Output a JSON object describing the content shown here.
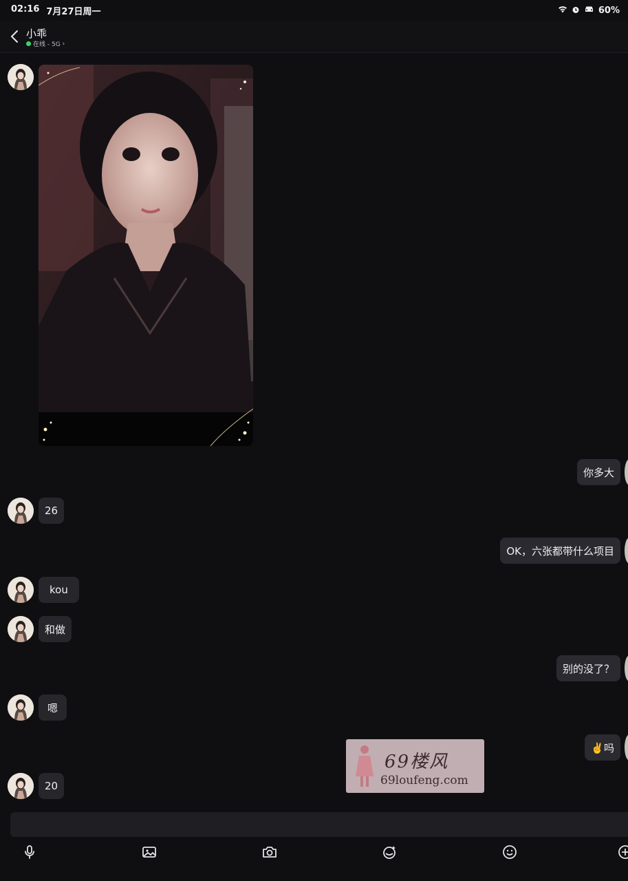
{
  "status_bar": {
    "time": "02:16",
    "date": "7月27日周一",
    "battery": "60%",
    "icons": [
      "wifi-icon",
      "alarm-icon",
      "car-icon"
    ]
  },
  "header": {
    "contact_name": "小乖",
    "status_text": "在线 - 5G",
    "status_chevron": "›"
  },
  "messages": [
    {
      "side": "in",
      "type": "image",
      "label": "photo"
    },
    {
      "side": "out",
      "text": "你多大"
    },
    {
      "side": "in",
      "text": "26"
    },
    {
      "side": "out",
      "text": "OK，六张都带什么项目"
    },
    {
      "side": "in",
      "text": "kou"
    },
    {
      "side": "in",
      "text": "和做"
    },
    {
      "side": "out",
      "text": "别的没了？"
    },
    {
      "side": "in",
      "text": "嗯"
    },
    {
      "side": "out",
      "text": "✌️吗"
    },
    {
      "side": "in",
      "text": "20"
    }
  ],
  "watermark": {
    "title": "69楼风",
    "url": "69loufeng.com"
  },
  "toolbar": {
    "items": [
      "microphone-icon",
      "gallery-icon",
      "camera-icon",
      "sticker-icon",
      "emoji-icon",
      "plus-icon"
    ]
  },
  "colors": {
    "background": "#0f0f12",
    "bubble": "#26262b",
    "online": "#37d66a"
  }
}
